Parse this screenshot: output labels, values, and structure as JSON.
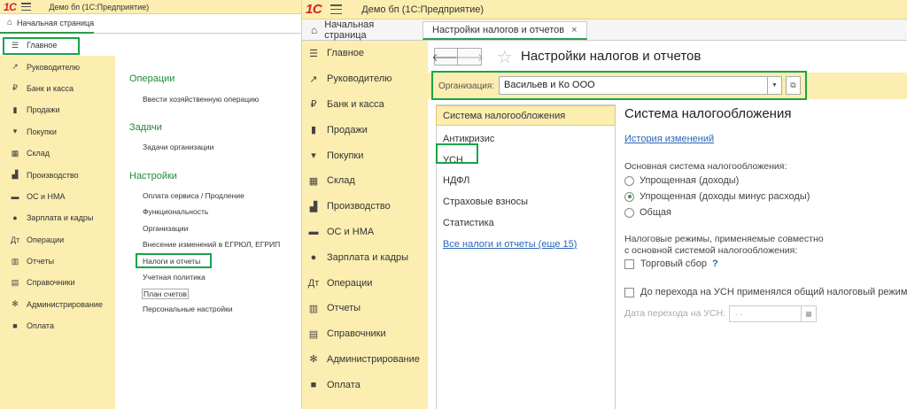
{
  "left_window": {
    "logo": "1С",
    "title": "Демо бп  (1С:Предприятие)",
    "home_tab": "Начальная страница",
    "sidebar": [
      {
        "label": "Главное",
        "icon": "☰",
        "icon_name": "menu-icon"
      },
      {
        "label": "Руководителю",
        "icon": "↗",
        "icon_name": "trend-icon"
      },
      {
        "label": "Банк и касса",
        "icon": "₽",
        "icon_name": "ruble-icon"
      },
      {
        "label": "Продажи",
        "icon": "▮",
        "icon_name": "bag-icon"
      },
      {
        "label": "Покупки",
        "icon": "▾",
        "icon_name": "cart-icon"
      },
      {
        "label": "Склад",
        "icon": "▦",
        "icon_name": "warehouse-icon"
      },
      {
        "label": "Производство",
        "icon": "▟",
        "icon_name": "factory-icon"
      },
      {
        "label": "ОС и НМА",
        "icon": "▬",
        "icon_name": "truck-icon"
      },
      {
        "label": "Зарплата и кадры",
        "icon": "●",
        "icon_name": "person-icon"
      },
      {
        "label": "Операции",
        "icon": "Дт",
        "icon_name": "operations-icon"
      },
      {
        "label": "Отчеты",
        "icon": "▥",
        "icon_name": "reports-icon"
      },
      {
        "label": "Справочники",
        "icon": "▤",
        "icon_name": "books-icon"
      },
      {
        "label": "Администрирование",
        "icon": "✻",
        "icon_name": "gear-icon"
      },
      {
        "label": "Оплата",
        "icon": "■",
        "icon_name": "payment-icon"
      }
    ],
    "sections": {
      "operations": {
        "title": "Операции",
        "links": [
          "Ввести хозяйственную операцию"
        ]
      },
      "tasks": {
        "title": "Задачи",
        "links": [
          "Задачи организации"
        ]
      },
      "settings": {
        "title": "Настройки",
        "links": [
          "Оплата сервиса / Продление",
          "Функциональность",
          "Организации",
          "Внесение изменений в ЕГРЮЛ, ЕГРИП",
          "Налоги и отчеты",
          "Учетная политика",
          "План счетов",
          "Персональные настройки"
        ]
      }
    }
  },
  "right_window": {
    "logo": "1С",
    "title": "Демо бп  (1С:Предприятие)",
    "home_tab": "Начальная страница",
    "active_tab": "Настройки налогов и отчетов",
    "close_glyph": "×",
    "sidebar": [
      {
        "label": "Главное",
        "icon": "☰",
        "icon_name": "menu-icon"
      },
      {
        "label": "Руководителю",
        "icon": "↗",
        "icon_name": "trend-icon"
      },
      {
        "label": "Банк и касса",
        "icon": "₽",
        "icon_name": "ruble-icon"
      },
      {
        "label": "Продажи",
        "icon": "▮",
        "icon_name": "bag-icon"
      },
      {
        "label": "Покупки",
        "icon": "▾",
        "icon_name": "cart-icon"
      },
      {
        "label": "Склад",
        "icon": "▦",
        "icon_name": "warehouse-icon"
      },
      {
        "label": "Производство",
        "icon": "▟",
        "icon_name": "factory-icon"
      },
      {
        "label": "ОС и НМА",
        "icon": "▬",
        "icon_name": "truck-icon"
      },
      {
        "label": "Зарплата и кадры",
        "icon": "●",
        "icon_name": "person-icon"
      },
      {
        "label": "Операции",
        "icon": "Дт",
        "icon_name": "operations-icon"
      },
      {
        "label": "Отчеты",
        "icon": "▥",
        "icon_name": "reports-icon"
      },
      {
        "label": "Справочники",
        "icon": "▤",
        "icon_name": "books-icon"
      },
      {
        "label": "Администрирование",
        "icon": "✻",
        "icon_name": "gear-icon"
      },
      {
        "label": "Оплата",
        "icon": "■",
        "icon_name": "payment-icon"
      }
    ],
    "page_title": "Настройки налогов и отчетов",
    "nav": {
      "back": "🡐",
      "forward": "🡒",
      "star": "☆"
    },
    "organization": {
      "label": "Организация:",
      "value": "Васильев и Ко ООО",
      "dropdown_glyph": "▼",
      "open_glyph": "⧉"
    },
    "left_list": {
      "items": [
        "Система налогообложения",
        "Антикризис",
        "УСН",
        "НДФЛ",
        "Страховые взносы",
        "Статистика"
      ],
      "all_link": "Все налоги и отчеты (еще 15)"
    },
    "form": {
      "heading": "Система налогообложения",
      "history_link": "История изменений",
      "main_system_label": "Основная система налогообложения:",
      "options": [
        "Упрощенная (доходы)",
        "Упрощенная (доходы минус расходы)",
        "Общая"
      ],
      "selected_option": 1,
      "combined_label_1": "Налоговые режимы, применяемые совместно",
      "combined_label_2": "с основной системой налогообложения:",
      "trade_fee_label": "Торговый сбор",
      "general_before_usn_label": "До перехода на УСН применялся общий налоговый режим",
      "help_glyph": "?",
      "transition_date_label": "Дата перехода на УСН:",
      "transition_date_value": ".  .",
      "calendar_glyph": "▦"
    }
  },
  "colors": {
    "sidebar_bg": "#fbeeb0",
    "accent_green": "#2f9b47",
    "highlight_box": "#1aa34a",
    "link_blue": "#2a66b8",
    "section_green": "#208a3b",
    "logo_red": "#d2232a"
  }
}
